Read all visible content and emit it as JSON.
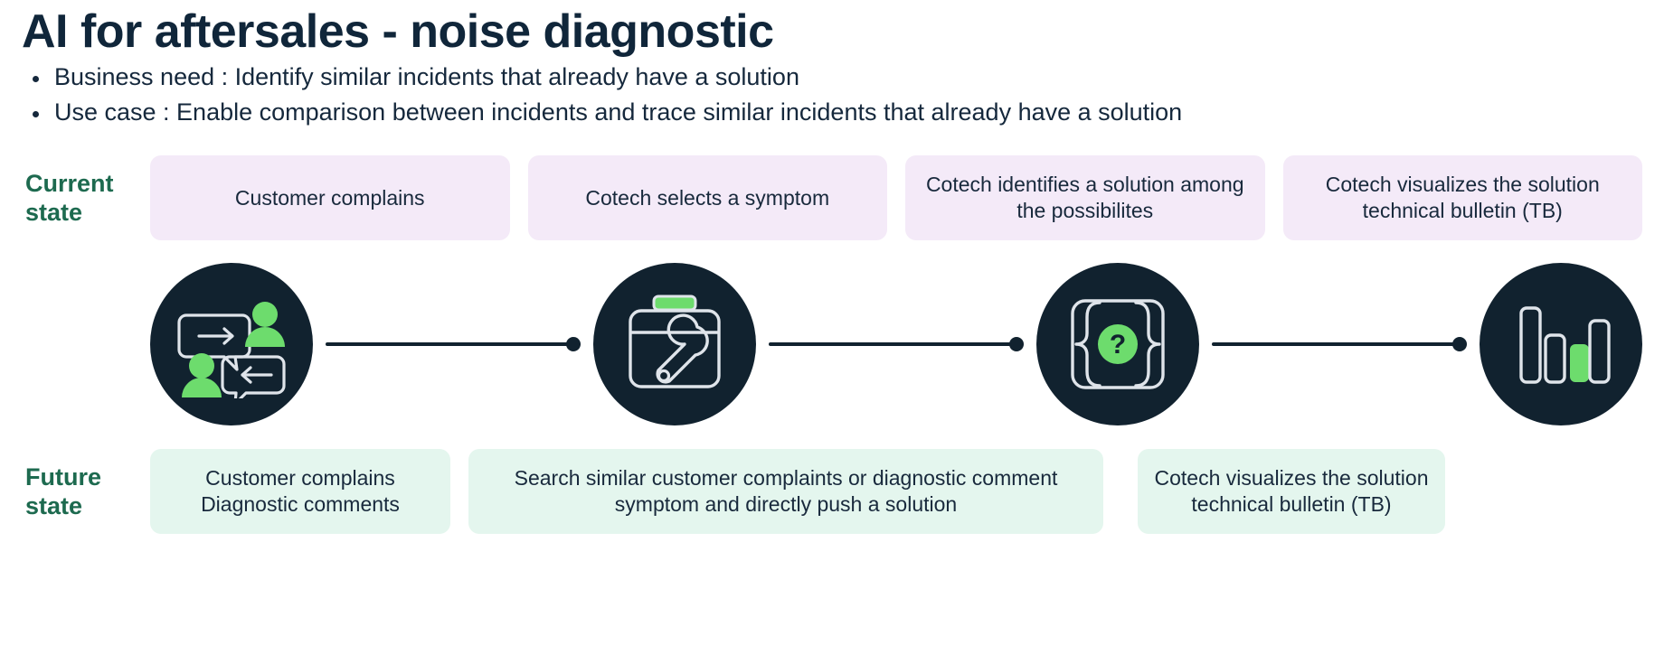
{
  "header": {
    "title": "AI for aftersales - noise diagnostic",
    "bullets": [
      "Business need : Identify similar incidents that already have a solution",
      "Use case : Enable comparison between incidents and trace similar incidents that already have a solution"
    ]
  },
  "current_state": {
    "label": "Current state",
    "cards": [
      "Customer complains",
      "Cotech selects a symptom",
      "Cotech identifies a solution among the possibilites",
      "Cotech visualizes the solution technical bulletin (TB)"
    ]
  },
  "icons": [
    {
      "name": "people-chat-icon",
      "alt": "Two people with speech bubbles"
    },
    {
      "name": "toolbox-wrench-icon",
      "alt": "Toolbox with wrench"
    },
    {
      "name": "brackets-question-icon",
      "alt": "Brackets around question mark"
    },
    {
      "name": "bar-chart-icon",
      "alt": "Bar chart"
    }
  ],
  "future_state": {
    "label": "Future state",
    "cards": [
      "Customer complains Diagnostic comments",
      "Search similar customer complaints or diagnostic comment symptom and directly push a solution",
      "Cotech visualizes the solution technical bulletin (TB)"
    ]
  },
  "colors": {
    "dark_navy": "#11222f",
    "accent_green": "#6ddc6d",
    "label_green": "#1d6a4f",
    "card_purple": "#f4eaf8",
    "card_mint": "#e4f6ee",
    "text": "#18293c"
  }
}
